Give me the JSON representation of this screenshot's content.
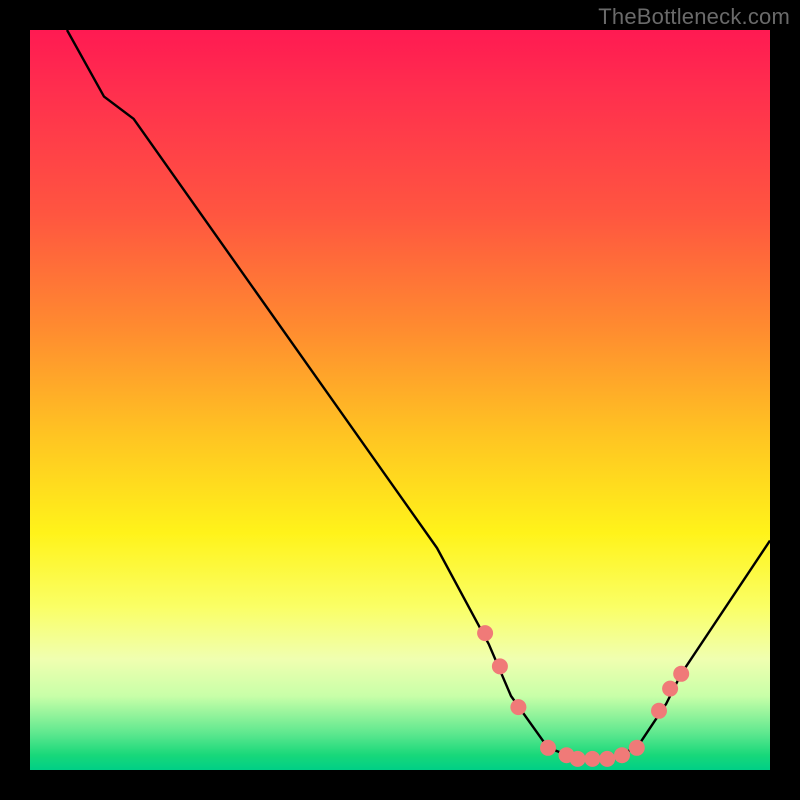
{
  "attribution": "TheBottleneck.com",
  "chart_data": {
    "type": "line",
    "title": "",
    "xlabel": "",
    "ylabel": "",
    "xlim": [
      0,
      100
    ],
    "ylim": [
      0,
      100
    ],
    "series": [
      {
        "name": "curve",
        "x": [
          5,
          10,
          14,
          55,
          62,
          65,
          70,
          74,
          78,
          82,
          86,
          88,
          100
        ],
        "y": [
          100,
          91,
          88,
          30,
          17,
          10,
          3,
          1.5,
          1.5,
          3,
          9,
          13,
          31
        ]
      }
    ],
    "markers": {
      "name": "dots",
      "color": "#f07a78",
      "x": [
        61.5,
        63.5,
        66,
        70,
        72.5,
        74,
        76,
        78,
        80,
        82,
        85,
        86.5,
        88
      ],
      "y": [
        18.5,
        14,
        8.5,
        3,
        2,
        1.5,
        1.5,
        1.5,
        2,
        3,
        8,
        11,
        13
      ]
    }
  }
}
